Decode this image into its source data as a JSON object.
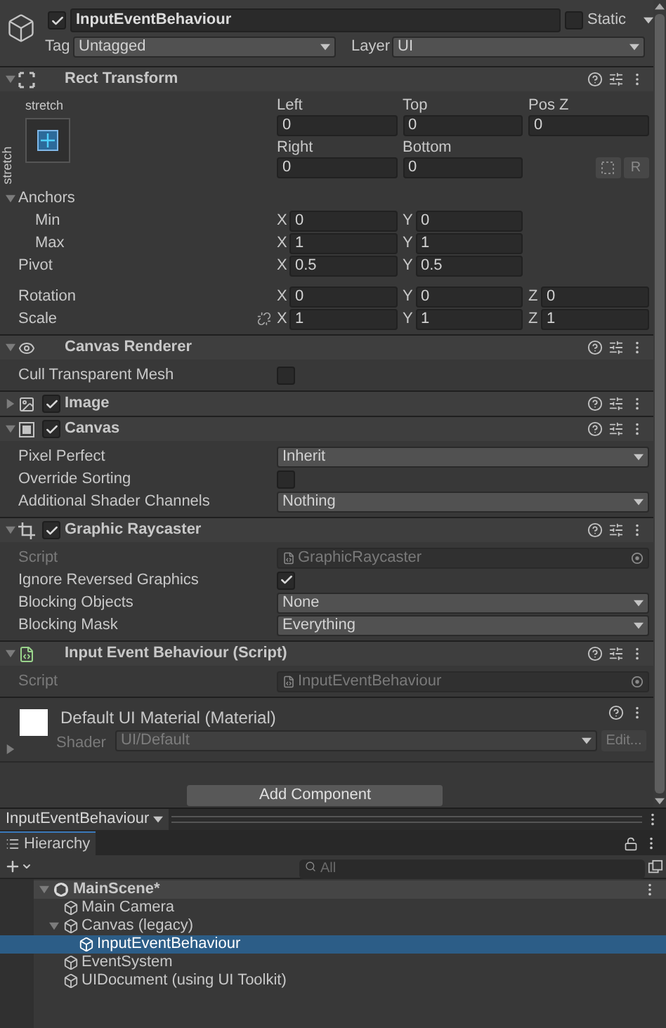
{
  "header": {
    "active": true,
    "name": "InputEventBehaviour",
    "static": false,
    "static_label": "Static",
    "tag_label": "Tag",
    "tag": "Untagged",
    "layer_label": "Layer",
    "layer": "UI"
  },
  "components": [
    {
      "kind": "rect_transform",
      "title": "Rect Transform",
      "expanded": true,
      "rect": {
        "preset_top": "stretch",
        "preset_side": "stretch",
        "offsets": [
          {
            "label": "Left",
            "value": "0"
          },
          {
            "label": "Top",
            "value": "0"
          },
          {
            "label": "Pos Z",
            "value": "0"
          },
          {
            "label": "Right",
            "value": "0"
          },
          {
            "label": "Bottom",
            "value": "0"
          }
        ],
        "raw_button": "R",
        "anchors": {
          "label": "Anchors",
          "expanded": true,
          "rows": [
            {
              "label": "Min",
              "fields": [
                {
                  "axis": "X",
                  "value": "0"
                },
                {
                  "axis": "Y",
                  "value": "0"
                }
              ]
            },
            {
              "label": "Max",
              "fields": [
                {
                  "axis": "X",
                  "value": "1"
                },
                {
                  "axis": "Y",
                  "value": "1"
                }
              ]
            }
          ]
        },
        "pivot": {
          "label": "Pivot",
          "fields": [
            {
              "axis": "X",
              "value": "0.5"
            },
            {
              "axis": "Y",
              "value": "0.5"
            }
          ]
        },
        "rotation": {
          "label": "Rotation",
          "fields": [
            {
              "axis": "X",
              "value": "0"
            },
            {
              "axis": "Y",
              "value": "0"
            },
            {
              "axis": "Z",
              "value": "0"
            }
          ]
        },
        "scale": {
          "label": "Scale",
          "linked": false,
          "fields": [
            {
              "axis": "X",
              "value": "1"
            },
            {
              "axis": "Y",
              "value": "1"
            },
            {
              "axis": "Z",
              "value": "1"
            }
          ]
        }
      }
    },
    {
      "kind": "canvas_renderer",
      "title": "Canvas Renderer",
      "expanded": true,
      "properties": [
        {
          "kind": "checkbox",
          "label": "Cull Transparent Mesh",
          "checked": false
        }
      ]
    },
    {
      "kind": "image",
      "title": "Image",
      "expanded": false,
      "enabled": true
    },
    {
      "kind": "canvas",
      "title": "Canvas",
      "expanded": true,
      "enabled": true,
      "properties": [
        {
          "kind": "dropdown",
          "label": "Pixel Perfect",
          "value": "Inherit"
        },
        {
          "kind": "checkbox",
          "label": "Override Sorting",
          "checked": false
        },
        {
          "kind": "dropdown",
          "label": "Additional Shader Channels",
          "value": "Nothing"
        }
      ]
    },
    {
      "kind": "graphic_raycaster",
      "title": "Graphic Raycaster",
      "expanded": true,
      "enabled": true,
      "properties": [
        {
          "kind": "object",
          "label": "Script",
          "value": "GraphicRaycaster",
          "disabled": true
        },
        {
          "kind": "checkbox",
          "label": "Ignore Reversed Graphics",
          "checked": true
        },
        {
          "kind": "dropdown",
          "label": "Blocking Objects",
          "value": "None"
        },
        {
          "kind": "dropdown",
          "label": "Blocking Mask",
          "value": "Everything"
        }
      ]
    },
    {
      "kind": "script",
      "title": "Input Event Behaviour (Script)",
      "expanded": true,
      "properties": [
        {
          "kind": "object",
          "label": "Script",
          "value": "InputEventBehaviour",
          "disabled": true
        }
      ]
    }
  ],
  "material": {
    "name": "Default UI Material (Material)",
    "expanded": false,
    "shader_label": "Shader",
    "shader": "UI/Default",
    "edit_button": "Edit..."
  },
  "add_component": "Add Component",
  "breadcrumb": "InputEventBehaviour",
  "hierarchy": {
    "tab": "Hierarchy",
    "search_placeholder": "All",
    "tree": [
      {
        "kind": "scene",
        "name": "MainScene*",
        "expanded": true,
        "selected": false,
        "children": [
          {
            "kind": "object",
            "name": "Main Camera",
            "selected": false
          },
          {
            "kind": "object",
            "name": "Canvas (legacy)",
            "expanded": true,
            "selected": false,
            "children": [
              {
                "kind": "object",
                "name": "InputEventBehaviour",
                "selected": true
              }
            ]
          },
          {
            "kind": "object",
            "name": "EventSystem",
            "selected": false
          },
          {
            "kind": "object",
            "name": "UIDocument (using UI Toolkit)",
            "selected": false
          }
        ]
      }
    ]
  }
}
